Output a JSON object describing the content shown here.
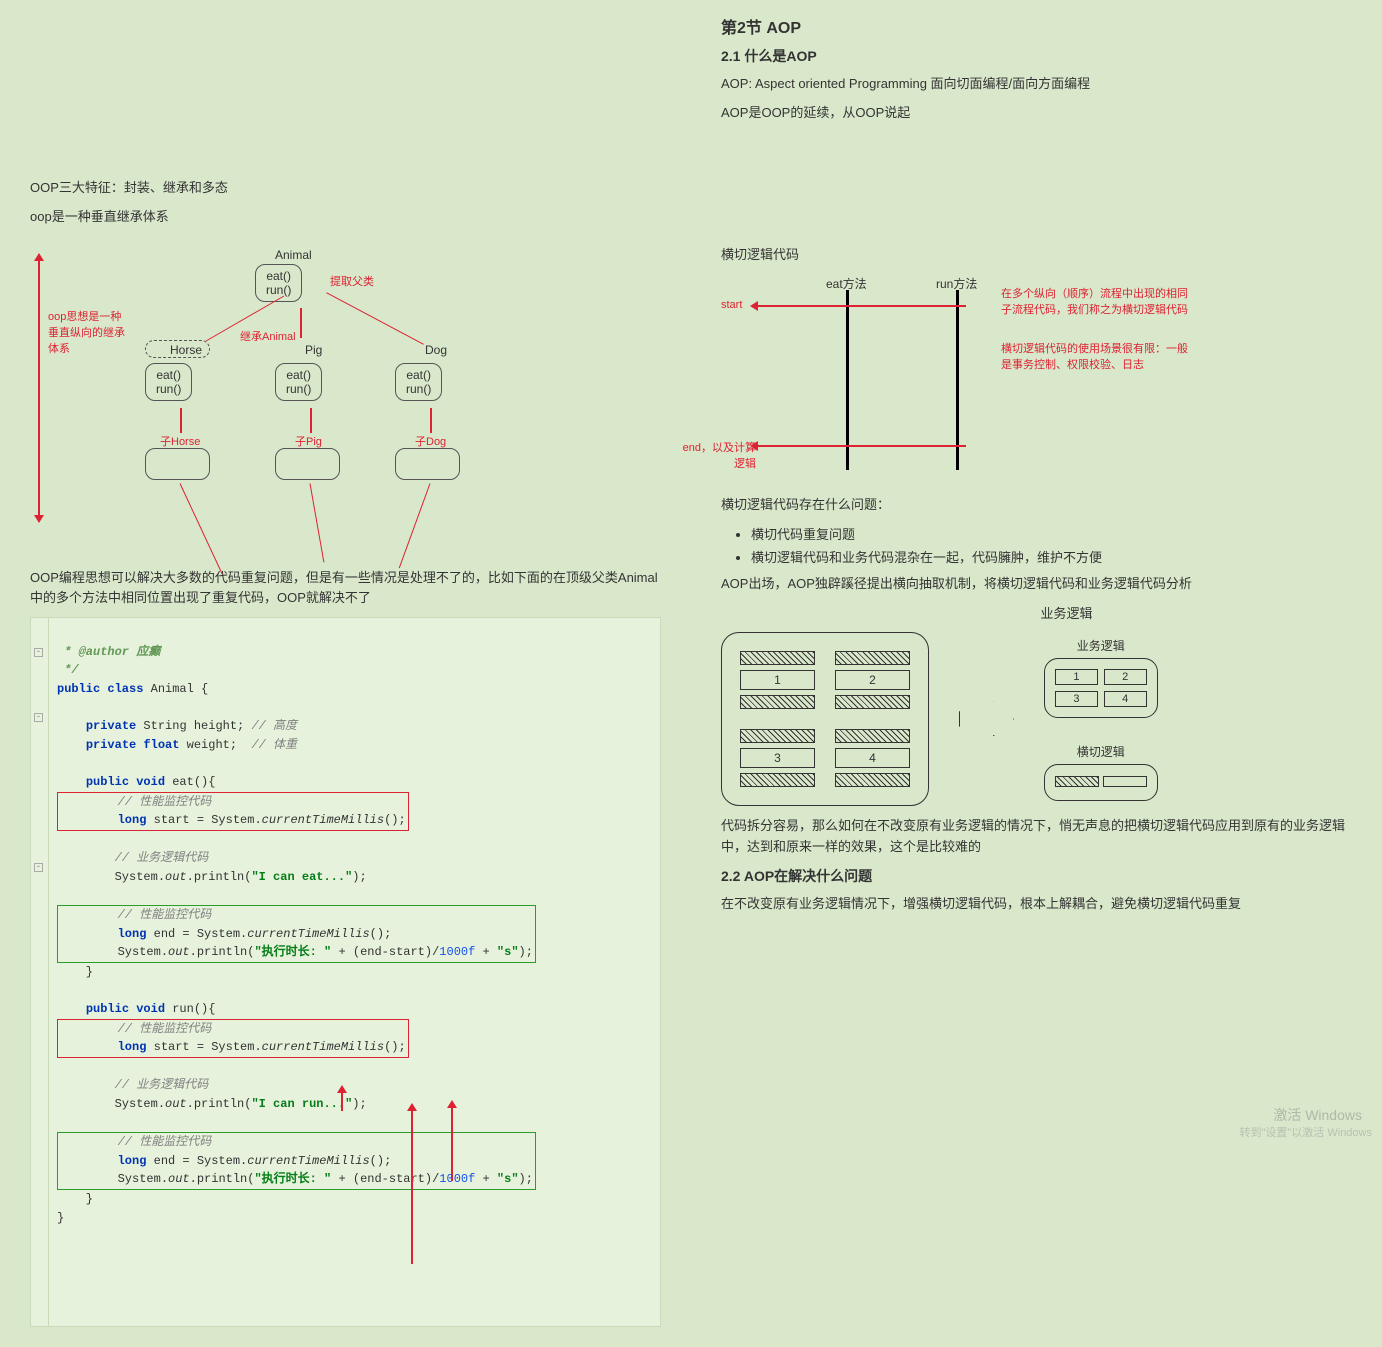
{
  "right": {
    "h2": "第2节 AOP",
    "h3_1": "2.1 什么是AOP",
    "p1": "AOP: Aspect oriented Programming 面向切面编程/面向方面编程",
    "p2": "AOP是OOP的延续，从OOP说起",
    "cross_title": "横切逻辑代码",
    "cross_eat": "eat方法",
    "cross_run": "run方法",
    "cross_start": "start",
    "cross_end": "end，以及计算逻辑",
    "cross_note1": "在多个纵向（顺序）流程中出现的相同子流程代码，我们称之为横切逻辑代码",
    "cross_note2": "横切逻辑代码的使用场景很有限：一般是事务控制、权限校验、日志",
    "problem_title": "横切逻辑代码存在什么问题：",
    "li1": "横切代码重复问题",
    "li2": "横切逻辑代码和业务代码混杂在一起，代码臃肿，维护不方便",
    "aop_intro": "AOP出场，AOP独辟蹊径提出横向抽取机制，将横切逻辑代码和业务逻辑代码分析",
    "biz_label": "业务逻辑",
    "biz_label2": "业务逻辑",
    "cross_label": "横切逻辑",
    "n1": "1",
    "n2": "2",
    "n3": "3",
    "n4": "4",
    "p_split": "代码拆分容易，那么如何在不改变原有业务逻辑的情况下，悄无声息的把横切逻辑代码应用到原有的业务逻辑中，达到和原来一样的效果，这个是比较难的",
    "h3_2": "2.2 AOP在解决什么问题",
    "p_final": "在不改变原有业务逻辑情况下，增强横切逻辑代码，根本上解耦合，避免横切逻辑代码重复"
  },
  "left": {
    "p1": "OOP三大特征：封装、继承和多态",
    "p2": "oop是一种垂直继承体系",
    "ann_side": "oop思想是一种垂直纵向的继承体系",
    "node_animal_t": "Animal",
    "node_animal_b": "eat()\nrun()",
    "lbl_extract": "提取父类",
    "lbl_inherit": "继承Animal",
    "horse": "Horse",
    "pig": "Pig",
    "dog": "Dog",
    "methods": "eat()\nrun()",
    "sub_h": "子Horse",
    "sub_p": "子Pig",
    "sub_d": "子Dog",
    "p3": "OOP编程思想可以解决大多数的代码重复问题，但是有一些情况是处理不了的，比如下面的在顶级父类Animal中的多个方法中相同位置出现了重复代码，OOP就解决不了",
    "code": {
      "c0": " * @author 应癫",
      "c0b": " */",
      "c1": "public class Animal {",
      "c2": "    private String height; // 高度",
      "c3": "    private float weight;  // 体重",
      "c4": "    public void eat(){",
      "c5": "        // 性能监控代码",
      "c6": "        long start = System.currentTimeMillis();",
      "c7": "        // 业务逻辑代码",
      "c8": "        System.out.println(\"I can eat...\");",
      "c9": "        // 性能监控代码",
      "c10": "        long end = System.currentTimeMillis();",
      "c11": "        System.out.println(\"执行时长: \" + (end-start)/1000f + \"s\");",
      "c12": "    }",
      "c13": "    public void run(){",
      "c14": "        // 性能监控代码",
      "c15": "        long start = System.currentTimeMillis();",
      "c16": "        // 业务逻辑代码",
      "c17": "        System.out.println(\"I can run...\");",
      "c18": "        // 性能监控代码",
      "c19": "        long end = System.currentTimeMillis();",
      "c20": "        System.out.println(\"执行时长: \" + (end-start)/1000f + \"s\");",
      "c21": "    }",
      "c22": "}"
    }
  },
  "wm": "激活 Windows",
  "wm2": "转到\"设置\"以激活 Windows"
}
